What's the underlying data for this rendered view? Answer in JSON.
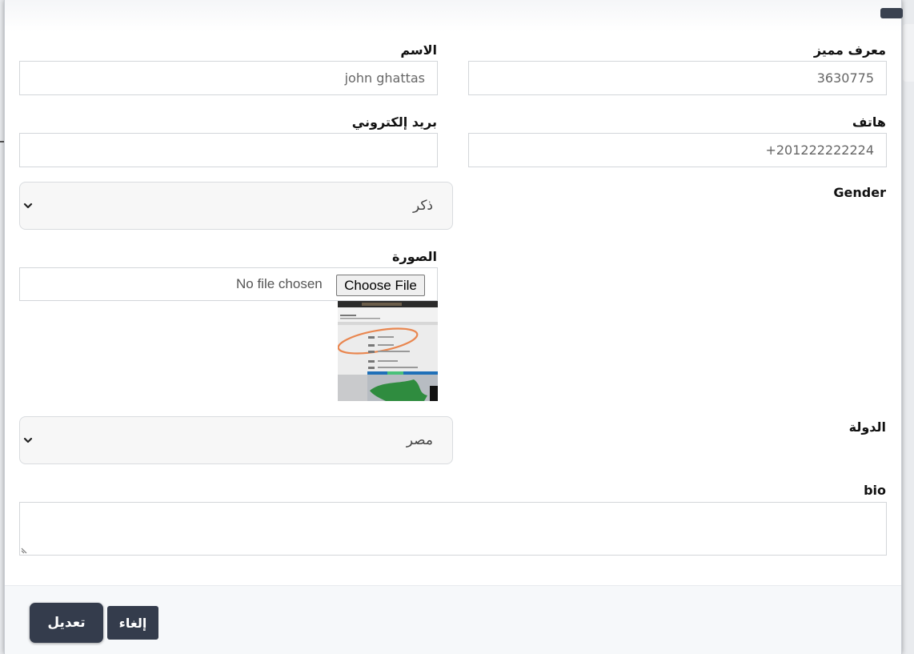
{
  "form": {
    "unique_id": {
      "label": "معرف مميز",
      "value": "3630775"
    },
    "name": {
      "label": "الاسم",
      "value": "john ghattas"
    },
    "phone": {
      "label": "هاتف",
      "value": "201222222224+"
    },
    "email": {
      "label": "بريد إلكتروني",
      "value": ""
    },
    "gender": {
      "label": "Gender",
      "selected": "ذكر"
    },
    "photo": {
      "label": "الصورة",
      "button_label": "Choose File",
      "status": "No file chosen"
    },
    "country": {
      "label": "الدولة",
      "selected": "مصر"
    },
    "bio": {
      "label": "bio",
      "value": ""
    }
  },
  "footer": {
    "submit_label": "تعديل",
    "cancel_label": "إلغاء"
  },
  "colors": {
    "primary_button": "#343c4c",
    "footer_bg": "#f6f8fa",
    "select_bg": "#f7f7f7"
  },
  "icons": {
    "close": "close-icon",
    "select_arrow": "chevron-down-icon",
    "resize": "resize-grip-icon"
  }
}
